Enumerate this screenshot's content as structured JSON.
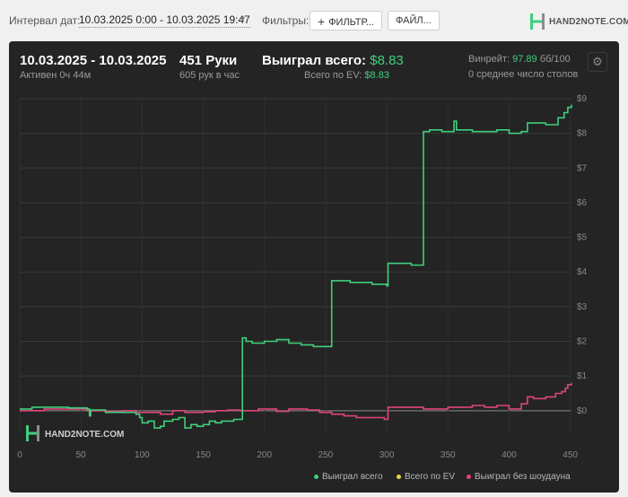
{
  "topbar": {
    "interval_label": "Интервал дат:",
    "interval_value": "10.03.2025 0:00 - 10.03.2025 19:47",
    "filters_label": "Фильтры:",
    "filters_button": "ФИЛЬТР...",
    "files_button": "ФАЙЛ...",
    "brand": "HAND2NOTE.COM"
  },
  "summary": {
    "date_range": "10.03.2025 - 10.03.2025",
    "active": "Активен 0ч 44м",
    "hands": "451 Руки",
    "hands_per_hour": "605 рук в час",
    "won_label": "Выиграл всего:",
    "won_value": "$8.83",
    "ev_label": "Всего по EV:",
    "ev_value": "$8.83",
    "winrate_label": "Винрейт:",
    "winrate_value": "97.89",
    "winrate_unit": "бб/100",
    "tables": "0 среднее число столов"
  },
  "colors": {
    "won": "#3fcf7b",
    "ev": "#e8d44d",
    "nonsd": "#e0457b",
    "panel": "#242424"
  },
  "chart_data": {
    "type": "line",
    "watermark": "HAND2NOTE.COM",
    "xlim": [
      0,
      451
    ],
    "ylim": [
      -0.6,
      9.0
    ],
    "x_ticks": [
      0,
      50,
      100,
      150,
      200,
      250,
      300,
      350,
      400,
      450
    ],
    "y_ticks": [
      0,
      1,
      2,
      3,
      4,
      5,
      6,
      7,
      8,
      9
    ],
    "y_tick_labels": [
      "$0",
      "$1",
      "$2",
      "$3",
      "$4",
      "$5",
      "$6",
      "$7",
      "$8",
      "$9"
    ],
    "legend": [
      "Выиграл всего",
      "Всего по EV",
      "Выиграл без шоудауна"
    ],
    "series": [
      {
        "name": "Выиграл всего",
        "points": [
          [
            0,
            0.05
          ],
          [
            10,
            0.1
          ],
          [
            25,
            0.1
          ],
          [
            40,
            0.08
          ],
          [
            55,
            0.05
          ],
          [
            57,
            -0.15
          ],
          [
            58,
            0.02
          ],
          [
            70,
            -0.05
          ],
          [
            85,
            -0.05
          ],
          [
            95,
            -0.1
          ],
          [
            98,
            -0.2
          ],
          [
            100,
            -0.35
          ],
          [
            105,
            -0.3
          ],
          [
            110,
            -0.5
          ],
          [
            115,
            -0.45
          ],
          [
            118,
            -0.3
          ],
          [
            125,
            -0.25
          ],
          [
            130,
            -0.2
          ],
          [
            135,
            -0.5
          ],
          [
            140,
            -0.4
          ],
          [
            145,
            -0.45
          ],
          [
            150,
            -0.4
          ],
          [
            155,
            -0.3
          ],
          [
            160,
            -0.35
          ],
          [
            165,
            -0.3
          ],
          [
            170,
            -0.3
          ],
          [
            175,
            -0.25
          ],
          [
            178,
            -0.25
          ],
          [
            181,
            -0.25
          ],
          [
            182,
            2.1
          ],
          [
            185,
            2.0
          ],
          [
            190,
            1.95
          ],
          [
            200,
            2.0
          ],
          [
            210,
            2.05
          ],
          [
            220,
            1.95
          ],
          [
            230,
            1.9
          ],
          [
            240,
            1.85
          ],
          [
            250,
            1.85
          ],
          [
            254,
            1.85
          ],
          [
            255,
            3.75
          ],
          [
            260,
            3.75
          ],
          [
            270,
            3.7
          ],
          [
            285,
            3.7
          ],
          [
            288,
            3.65
          ],
          [
            300,
            3.6
          ],
          [
            301,
            4.25
          ],
          [
            310,
            4.25
          ],
          [
            320,
            4.2
          ],
          [
            329,
            4.2
          ],
          [
            330,
            8.05
          ],
          [
            335,
            8.1
          ],
          [
            345,
            8.05
          ],
          [
            350,
            8.05
          ],
          [
            355,
            8.35
          ],
          [
            357,
            8.1
          ],
          [
            370,
            8.05
          ],
          [
            380,
            8.05
          ],
          [
            390,
            8.1
          ],
          [
            400,
            8.0
          ],
          [
            410,
            8.05
          ],
          [
            415,
            8.3
          ],
          [
            420,
            8.3
          ],
          [
            430,
            8.25
          ],
          [
            440,
            8.45
          ],
          [
            445,
            8.6
          ],
          [
            448,
            8.75
          ],
          [
            451,
            8.83
          ]
        ]
      },
      {
        "name": "Всего по EV",
        "points": [
          [
            0,
            0.05
          ],
          [
            451,
            0.05
          ]
        ]
      },
      {
        "name": "Выиграл без шоудауна",
        "points": [
          [
            0,
            0.0
          ],
          [
            20,
            0.05
          ],
          [
            40,
            0.05
          ],
          [
            55,
            0.0
          ],
          [
            70,
            -0.02
          ],
          [
            85,
            0.0
          ],
          [
            95,
            -0.05
          ],
          [
            100,
            -0.05
          ],
          [
            115,
            -0.1
          ],
          [
            125,
            0.0
          ],
          [
            135,
            -0.05
          ],
          [
            150,
            -0.03
          ],
          [
            160,
            0.0
          ],
          [
            170,
            0.02
          ],
          [
            180,
            0.0
          ],
          [
            195,
            0.05
          ],
          [
            210,
            -0.02
          ],
          [
            220,
            0.05
          ],
          [
            235,
            0.02
          ],
          [
            245,
            -0.05
          ],
          [
            255,
            -0.1
          ],
          [
            265,
            -0.15
          ],
          [
            275,
            -0.2
          ],
          [
            290,
            -0.2
          ],
          [
            298,
            -0.25
          ],
          [
            300,
            -0.25
          ],
          [
            301,
            0.1
          ],
          [
            315,
            0.1
          ],
          [
            330,
            0.05
          ],
          [
            345,
            0.05
          ],
          [
            350,
            0.1
          ],
          [
            360,
            0.1
          ],
          [
            370,
            0.15
          ],
          [
            380,
            0.1
          ],
          [
            390,
            0.15
          ],
          [
            400,
            0.05
          ],
          [
            405,
            0.05
          ],
          [
            410,
            0.2
          ],
          [
            415,
            0.4
          ],
          [
            420,
            0.35
          ],
          [
            430,
            0.4
          ],
          [
            438,
            0.5
          ],
          [
            443,
            0.55
          ],
          [
            446,
            0.65
          ],
          [
            448,
            0.75
          ],
          [
            451,
            0.8
          ]
        ]
      }
    ]
  }
}
